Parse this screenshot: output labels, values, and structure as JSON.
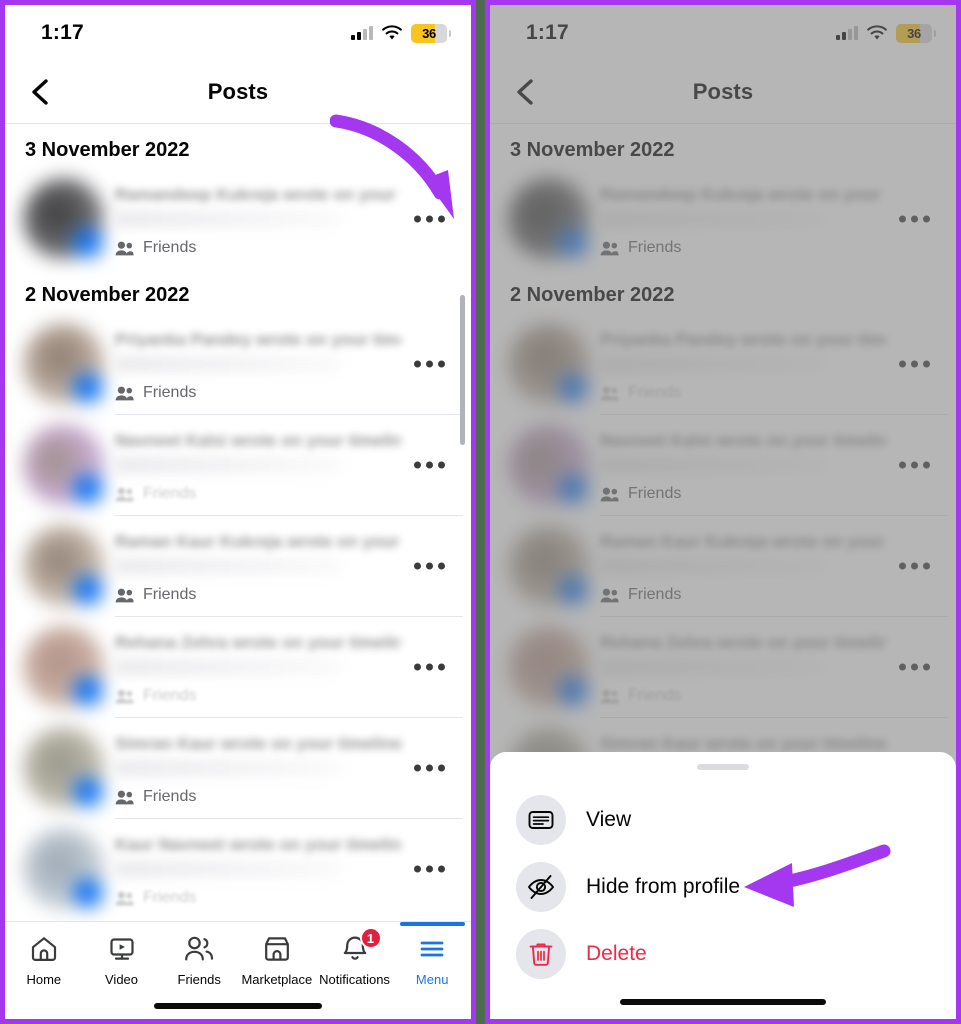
{
  "meta": {
    "accent_color": "#a438f0",
    "gap_color": "#4d6b4d",
    "brand_blue": "#1b74e4",
    "danger_red": "#f02849",
    "badge_red": "#e41e3f",
    "battery_yellow": "#f7c51e"
  },
  "status_bar": {
    "time": "1:17",
    "battery_level": "36",
    "cell_icon": "cellular-signal-icon",
    "wifi_icon": "wifi-icon",
    "battery_icon": "battery-low-power-icon"
  },
  "nav": {
    "back_icon": "chevron-left-icon",
    "title": "Posts"
  },
  "list": {
    "audience_icon": "friends-audience-icon",
    "menu_icon": "three-dots-icon",
    "sections": [
      {
        "date": "3 November 2022",
        "posts": [
          {
            "text": "Ramandeep Kukreja wrote on your timeline",
            "audience": "Friends",
            "blurred": true
          }
        ]
      },
      {
        "date": "2 November 2022",
        "posts": [
          {
            "text": "Priyanka Pandey wrote on your timeline",
            "audience": "Friends",
            "blurred": true
          },
          {
            "text": "Navneet Kalsi wrote on your timeline",
            "audience": "Friends",
            "blurred": true
          },
          {
            "text": "Raman Kaur Kukreja wrote on your timeline",
            "audience": "Friends",
            "blurred": true
          },
          {
            "text": "Rehana Zehra wrote on your timeline",
            "audience": "Friends",
            "blurred": true
          },
          {
            "text": "Simran Kaur wrote on your timeline",
            "audience": "Friends",
            "blurred": true
          },
          {
            "text": "Kaur Navneet wrote on your timeline",
            "audience": "Friends",
            "blurred": true
          }
        ]
      }
    ]
  },
  "tabbar": {
    "items": [
      {
        "label": "Home",
        "icon": "home-icon",
        "active": false,
        "badge": ""
      },
      {
        "label": "Video",
        "icon": "video-icon",
        "active": false,
        "badge": ""
      },
      {
        "label": "Friends",
        "icon": "friends-icon",
        "active": false,
        "badge": ""
      },
      {
        "label": "Marketplace",
        "icon": "marketplace-icon",
        "active": false,
        "badge": ""
      },
      {
        "label": "Notifications",
        "icon": "bell-icon",
        "active": false,
        "badge": "1"
      },
      {
        "label": "Menu",
        "icon": "hamburger-icon",
        "active": true,
        "badge": ""
      }
    ]
  },
  "action_sheet": {
    "grabber": "sheet-grabber",
    "items": [
      {
        "label": "View",
        "icon": "card-view-icon",
        "danger": false
      },
      {
        "label": "Hide from profile",
        "icon": "eye-slash-icon",
        "danger": false
      },
      {
        "label": "Delete",
        "icon": "trash-icon",
        "danger": true
      }
    ]
  },
  "annotations": [
    {
      "name": "arrow-to-post-menu",
      "target": "three-dots-icon",
      "color": "#a438f0"
    },
    {
      "name": "arrow-to-hide-option",
      "target": "Hide from profile",
      "color": "#a438f0"
    }
  ]
}
